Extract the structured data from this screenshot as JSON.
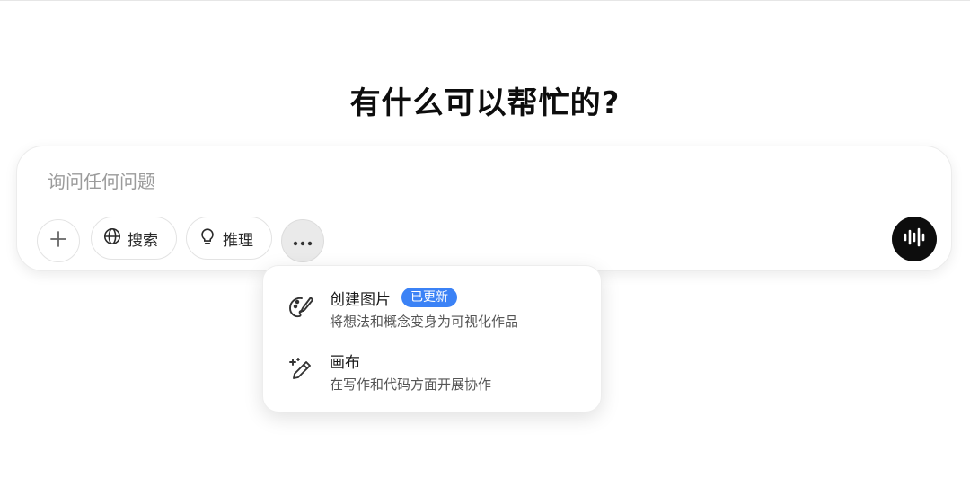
{
  "main": {
    "title": "有什么可以帮忙的?"
  },
  "composer": {
    "placeholder": "询问任何问题",
    "value": "",
    "tools": {
      "attach_icon": "plus-icon",
      "search": {
        "label": "搜索",
        "icon": "globe-icon"
      },
      "reason": {
        "label": "推理",
        "icon": "lightbulb-icon"
      },
      "more_icon": "ellipsis-icon",
      "voice_icon": "voice-waveform-icon"
    }
  },
  "tools_menu": {
    "items": [
      {
        "title": "创建图片",
        "badge": "已更新",
        "description": "将想法和概念变身为可视化作品",
        "icon": "paint-palette-icon"
      },
      {
        "title": "画布",
        "description": "在写作和代码方面开展协作",
        "icon": "pen-sparkle-icon"
      }
    ]
  },
  "colors": {
    "badge": "#3b82f6",
    "voice_button": "#0d0d0d",
    "placeholder": "#9b9b9b"
  }
}
